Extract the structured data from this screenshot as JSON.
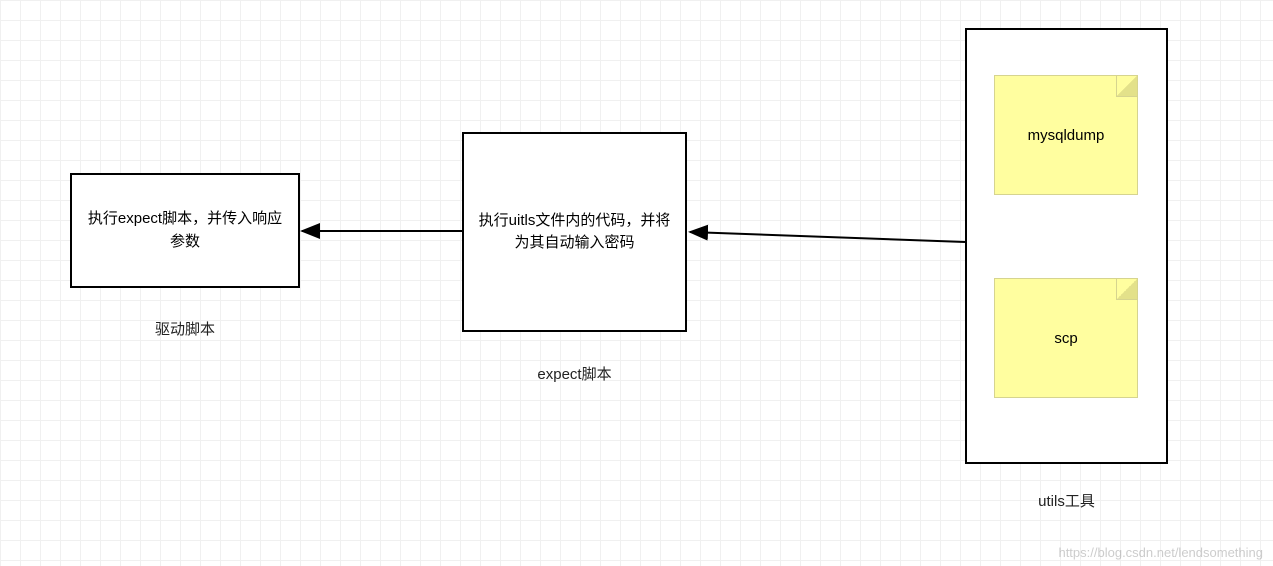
{
  "diagram": {
    "nodes": {
      "driver": {
        "text": "执行expect脚本，并传入响应参数",
        "label": "驱动脚本"
      },
      "expect": {
        "text": "执行uitls文件内的代码，并将为其自动输入密码",
        "label": "expect脚本"
      },
      "utils": {
        "label": "utils工具",
        "notes": {
          "mysqldump": "mysqldump",
          "scp": "scp"
        }
      }
    },
    "watermark": "https://blog.csdn.net/lendsomething"
  }
}
